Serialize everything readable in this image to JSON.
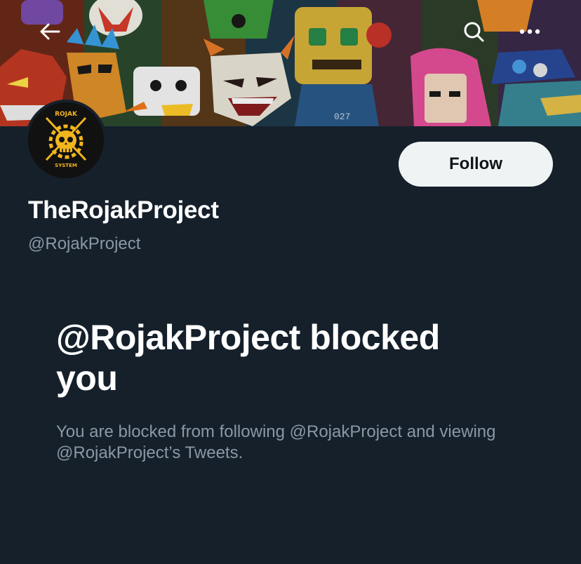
{
  "banner": {
    "icons": {
      "back": "back-arrow-icon",
      "search": "search-icon",
      "more": "more-dots-icon"
    },
    "artwork_tag": "027"
  },
  "profile": {
    "display_name": "TheRojakProject",
    "handle": "@RojakProject",
    "avatar_icon": "skull-logo-icon",
    "avatar_text_top": "ROJAK",
    "avatar_text_bottom": "SYSTEM"
  },
  "actions": {
    "follow_label": "Follow"
  },
  "blocked": {
    "title": "@RojakProject blocked you",
    "description": "You are blocked from following @RojakProject and viewing @RojakProject’s Tweets."
  },
  "colors": {
    "background": "#15202b",
    "primary_text": "#ffffff",
    "secondary_text": "#8b98a5",
    "button_bg": "#eff3f4",
    "button_text": "#0f1419",
    "logo_gold": "#f2b51d"
  }
}
